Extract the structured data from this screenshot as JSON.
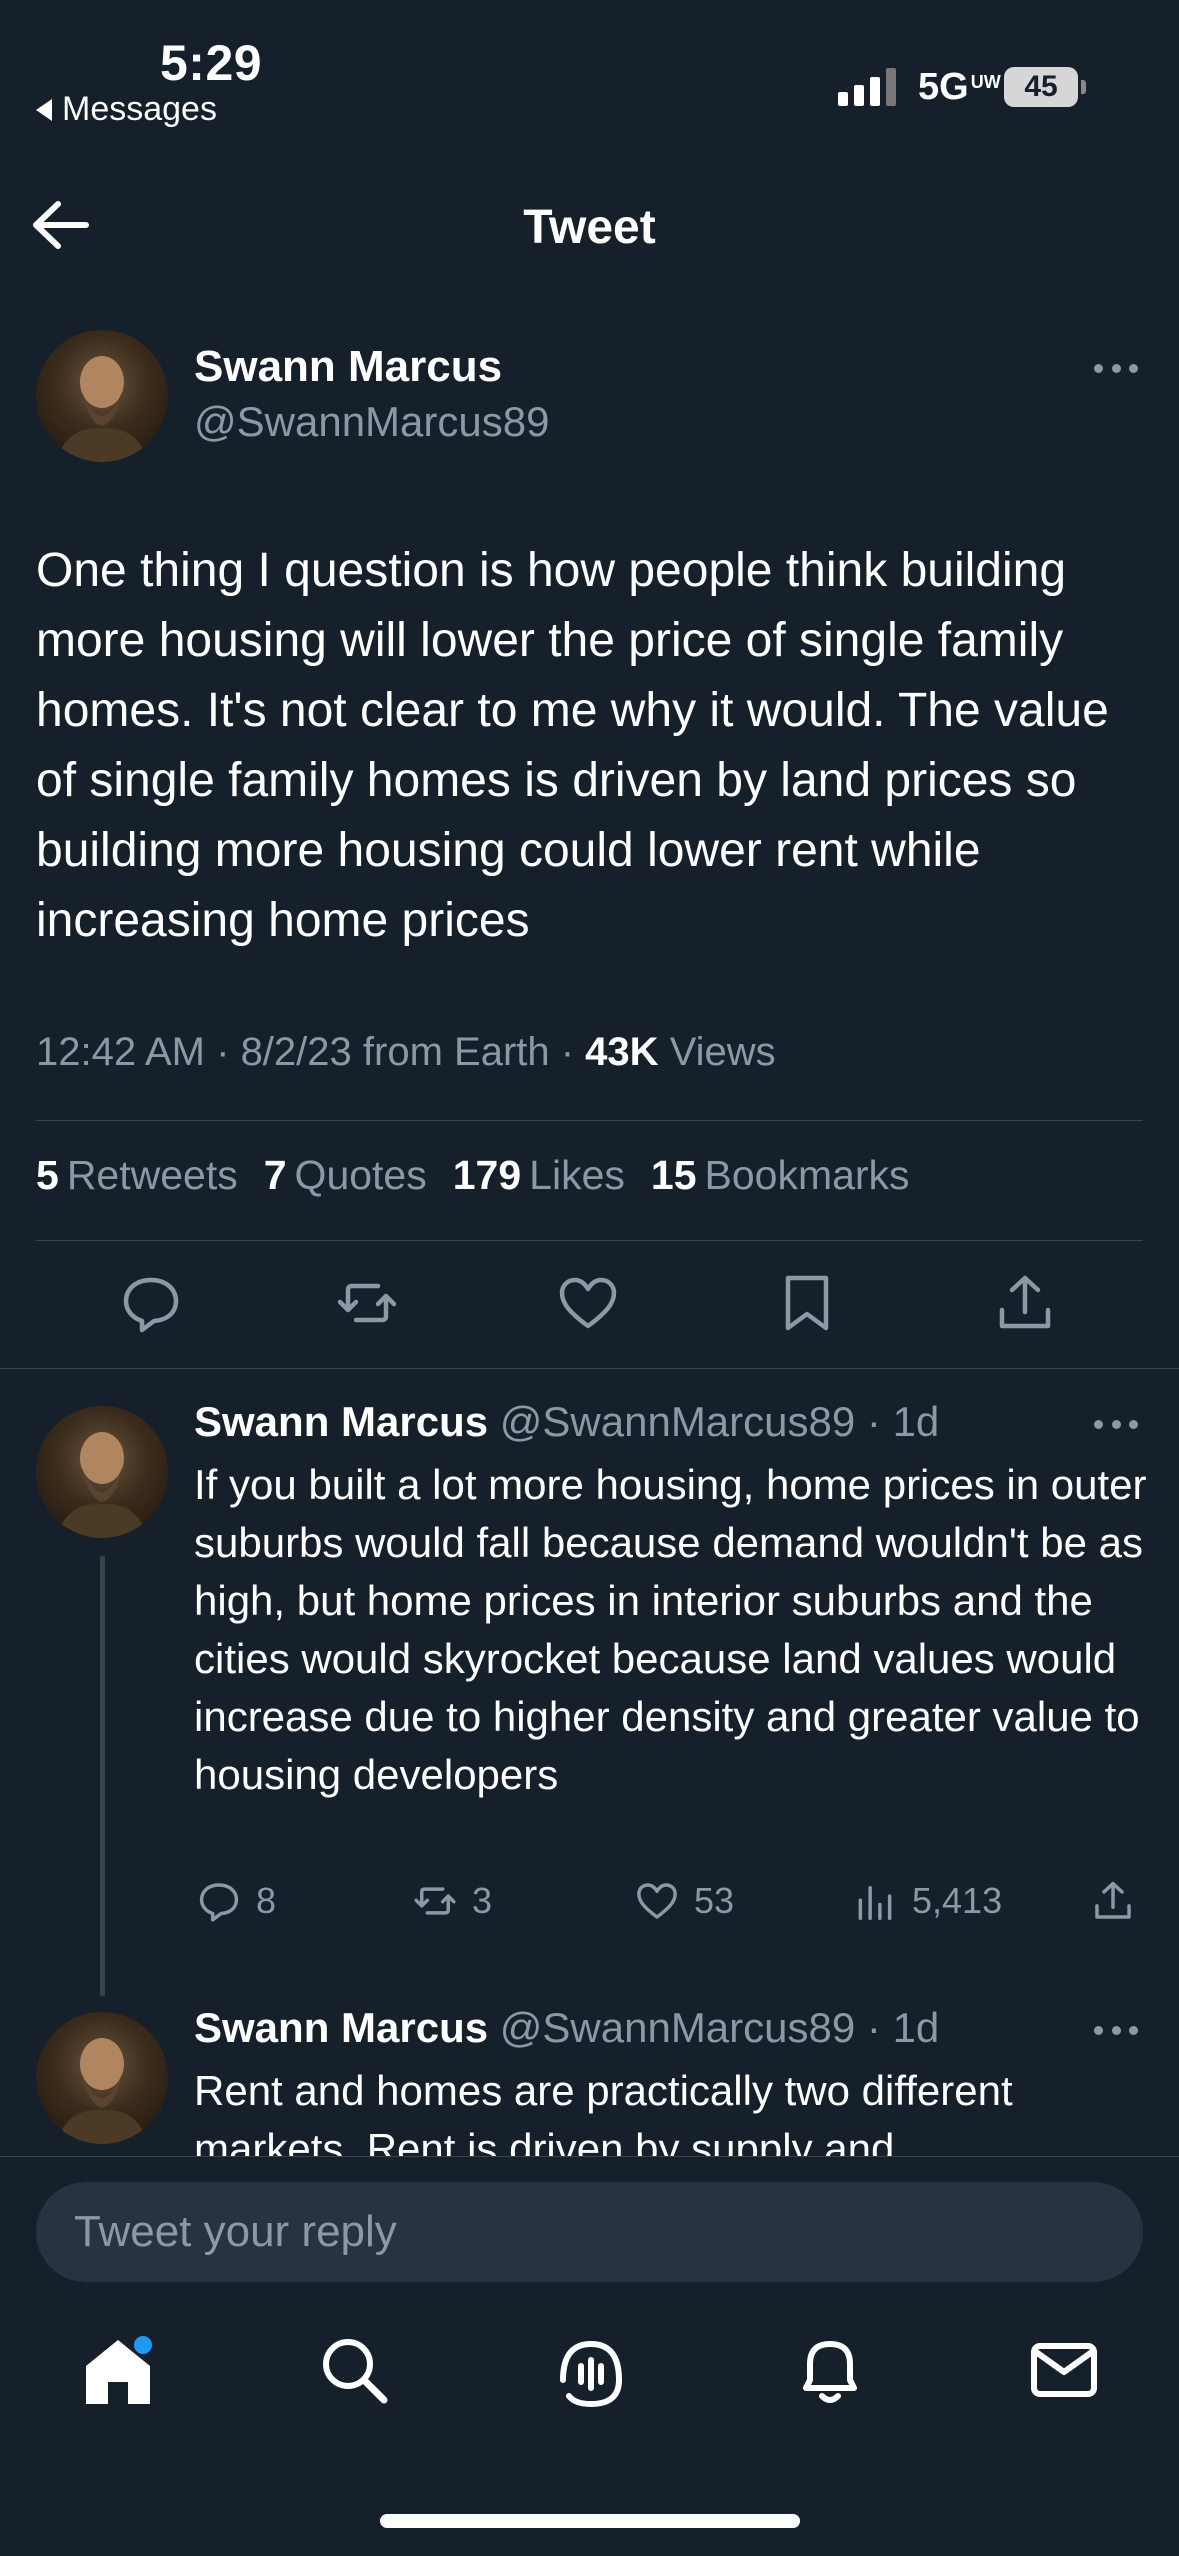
{
  "status_bar": {
    "time": "5:29",
    "back_app": "Messages",
    "network": "5G",
    "network_sup": "UW",
    "battery": "45"
  },
  "header": {
    "title": "Tweet"
  },
  "tweet": {
    "author_name": "Swann Marcus",
    "author_handle": "@SwannMarcus89",
    "text": "One thing I question is how people think building more housing will lower the price of single family homes.  It's not clear to me why it would.  The value of single family homes is driven by land prices so building more housing could lower rent while increasing home prices",
    "time": "12:42 AM",
    "date": "8/2/23",
    "source": "from Earth",
    "views_count": "43K",
    "views_label": "Views",
    "retweets_count": "5",
    "retweets_label": "Retweets",
    "quotes_count": "7",
    "quotes_label": "Quotes",
    "likes_count": "179",
    "likes_label": "Likes",
    "bookmarks_count": "15",
    "bookmarks_label": "Bookmarks"
  },
  "replies": [
    {
      "author_name": "Swann Marcus",
      "author_handle": "@SwannMarcus89",
      "age": "1d",
      "text": "If you built a lot more housing, home prices in outer suburbs would fall because demand wouldn't be as high, but home prices in interior suburbs and the cities would skyrocket because land values would increase due to higher density and greater value to housing developers",
      "replies": "8",
      "retweets": "3",
      "likes": "53",
      "views": "5,413"
    },
    {
      "author_name": "Swann Marcus",
      "author_handle": "@SwannMarcus89",
      "age": "1d",
      "text": "Rent and homes are practically two different markets.  Rent is driven by supply and"
    }
  ],
  "composer": {
    "placeholder": "Tweet your reply"
  },
  "tabbar": {
    "items": [
      "home-icon",
      "search-icon",
      "spaces-icon",
      "notifications-icon",
      "messages-icon"
    ]
  },
  "colors": {
    "background": "#15202b",
    "muted": "#8b98a5",
    "accent": "#1d9bf0",
    "divider": "#38444d"
  }
}
